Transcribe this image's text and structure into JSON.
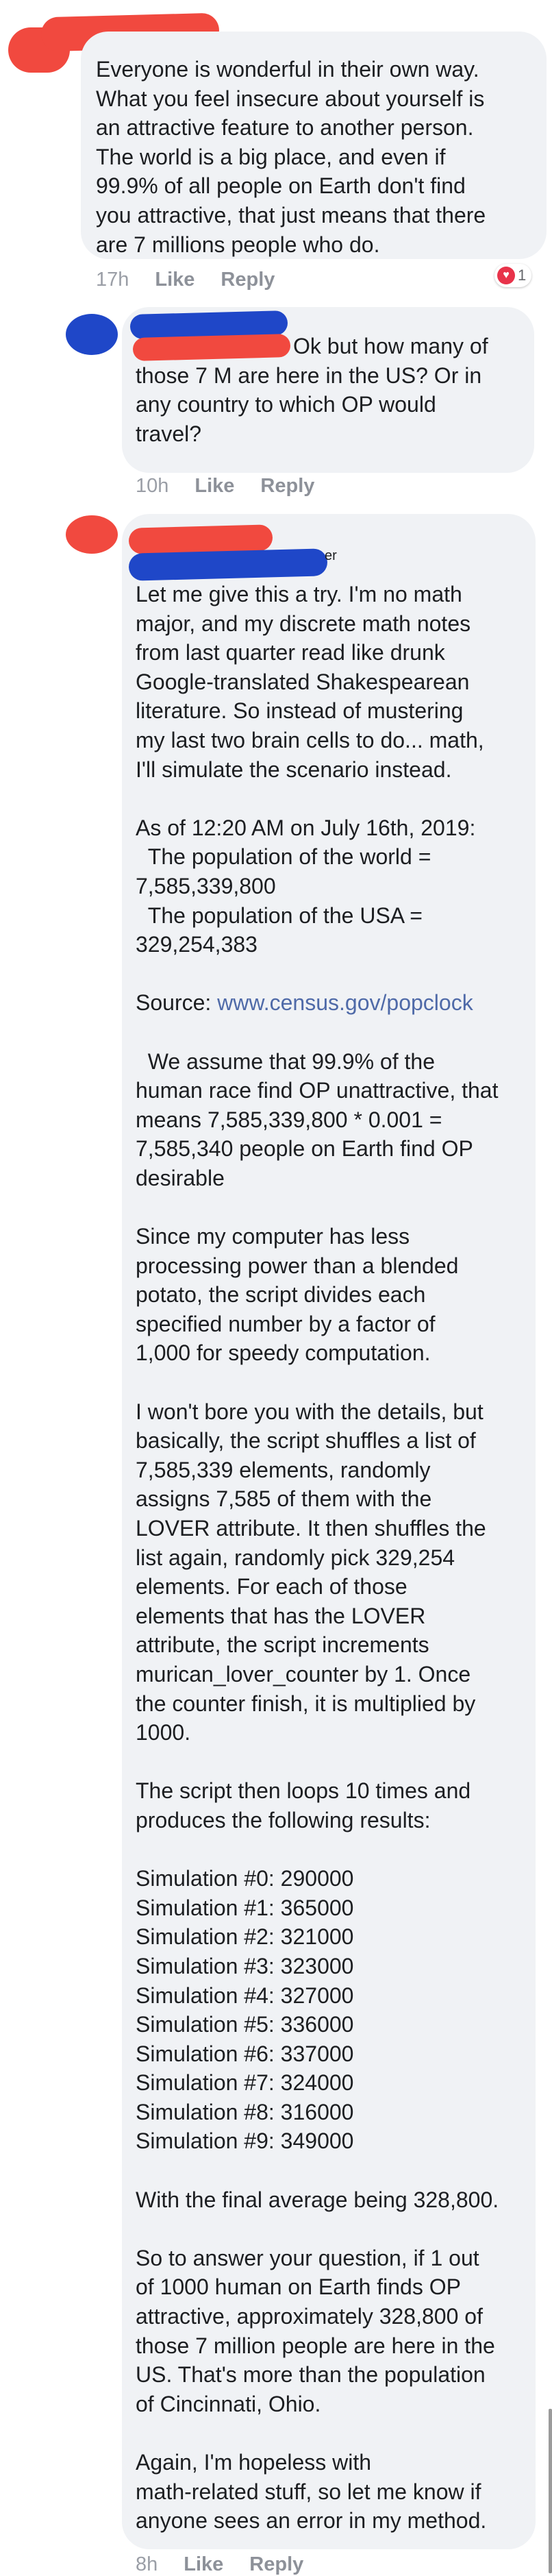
{
  "comments": [
    {
      "text": "Everyone is wonderful in their own way.\nWhat you feel insecure about yourself is\nan attractive feature to another person.\nThe world is a big place, and even if\n99.9% of all people on Earth don't find\nyou attractive, that just means that there\nare 7 millions people who do.",
      "time": "17h",
      "like_label": "Like",
      "reply_label": "Reply",
      "reaction_icon": "heart-icon",
      "reaction_count": "1"
    },
    {
      "text_first": "Ok but how many of",
      "text_rest": "those 7 M are here in the US? Or in\nany country to which OP would\ntravel?",
      "time": "10h",
      "like_label": "Like",
      "reply_label": "Reply"
    },
    {
      "name_fragment": "er",
      "p1": "Let me give this a try. I'm no math\nmajor, and my discrete math notes\nfrom last quarter read like drunk\nGoogle-translated Shakespearean\nliterature. So instead of mustering\nmy last two brain cells to do... math,\nI'll simulate the scenario instead.",
      "p2": "As of 12:20 AM on July 16th, 2019:\n  The population of the world =\n7,585,339,800\n  The population of the USA =\n329,254,383",
      "source_label": "Source: ",
      "source_link": "www.census.gov/popclock",
      "p3": "  We assume that 99.9% of the\nhuman race find OP unattractive, that\nmeans 7,585,339,800 * 0.001 =\n7,585,340 people on Earth find OP\ndesirable",
      "p4": "Since my computer has less\nprocessing power than a blended\npotato, the script divides each\nspecified number by a factor of\n1,000 for speedy computation.",
      "p5": "I won't bore you with the details, but\nbasically, the script shuffles a list of\n7,585,339 elements, randomly\nassigns 7,585 of them with the\nLOVER attribute. It then shuffles the\nlist again, randomly pick 329,254\nelements. For each of those\nelements that has the LOVER\nattribute, the script increments\nmurican_lover_counter by 1. Once\nthe counter finish, it is multiplied by\n1000.",
      "p6": "The script then loops 10 times and\nproduces the following results:",
      "simulations": [
        "Simulation #0: 290000",
        "Simulation #1: 365000",
        "Simulation #2: 321000",
        "Simulation #3: 323000",
        "Simulation #4: 327000",
        "Simulation #5: 336000",
        "Simulation #6: 337000",
        "Simulation #7: 324000",
        "Simulation #8: 316000",
        "Simulation #9: 349000"
      ],
      "p7": "With the final average being 328,800.",
      "p8": "So to answer your question, if 1 out\nof 1000 human on Earth finds OP\nattractive, approximately 328,800 of\nthose 7 million people are here in the\nUS. That's more than the population\nof Cincinnati, Ohio.",
      "p9": "Again, I'm hopeless with\nmath-related stuff, so let me know if\nanyone sees an error in my method.",
      "time": "8h",
      "like_label": "Like",
      "reply_label": "Reply"
    }
  ],
  "colors": {
    "redaction_red": "#f1493f",
    "redaction_blue": "#1f47c8",
    "bubble_bg": "#f0f2f5",
    "link": "#4f6aa8"
  }
}
